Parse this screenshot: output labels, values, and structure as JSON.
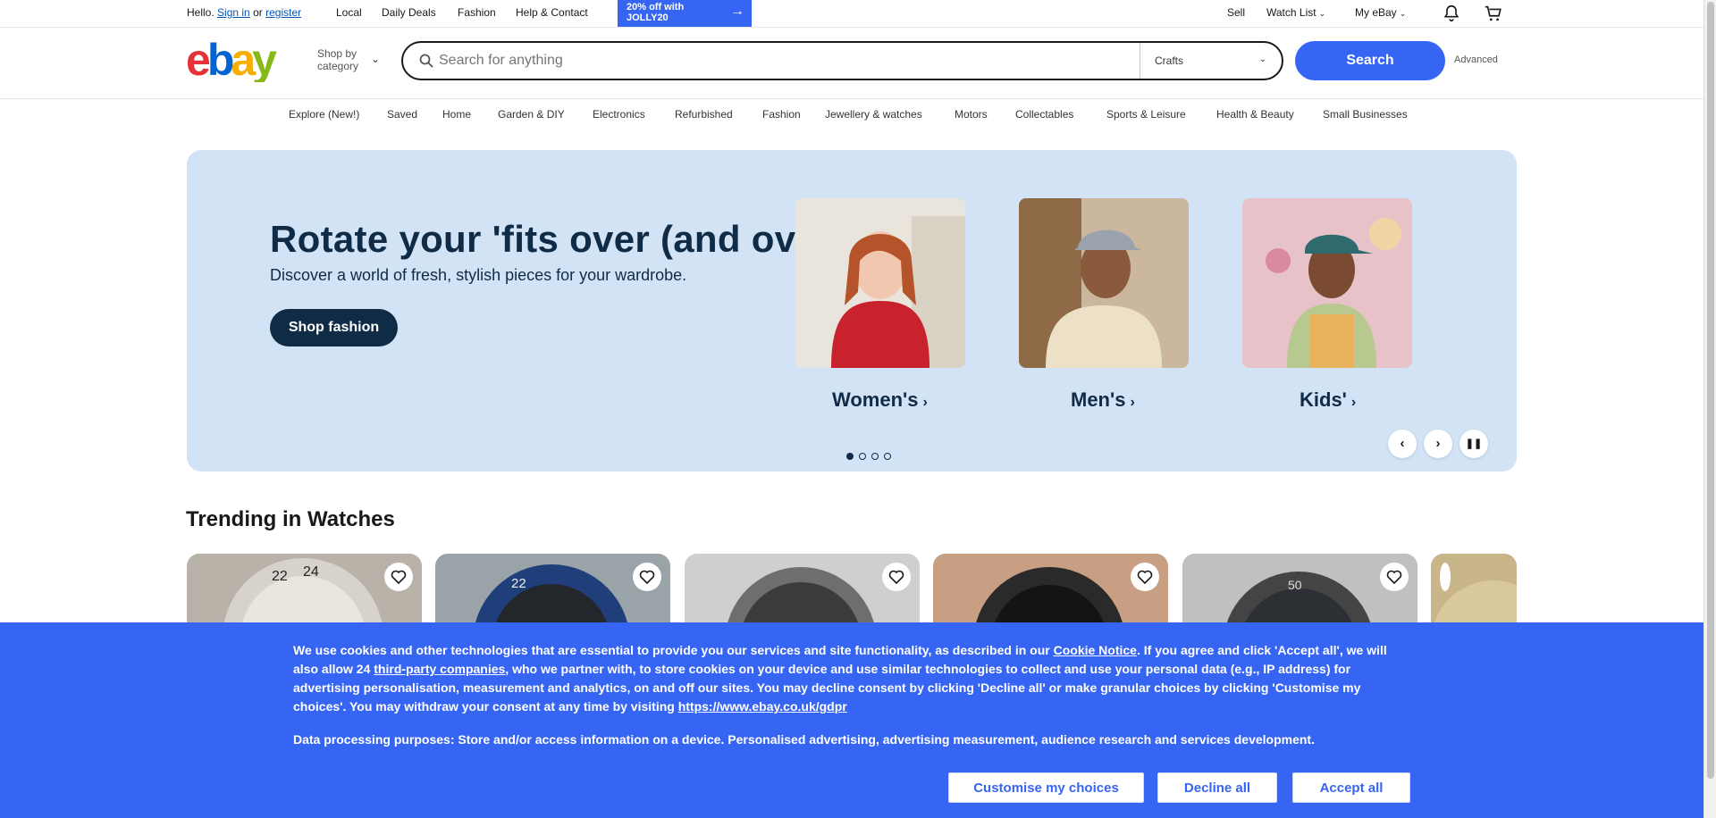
{
  "topbar": {
    "hello": "Hello.",
    "sign_in": "Sign in",
    "or": "or",
    "register": "register",
    "links": [
      "Local",
      "Daily Deals",
      "Fashion",
      "Help & Contact"
    ],
    "promo": "20% off with JOLLY20",
    "sell": "Sell",
    "watch_list": "Watch List",
    "my_ebay": "My eBay"
  },
  "header": {
    "shop_by_category": "Shop by category",
    "search_placeholder": "Search for anything",
    "category_selected": "Crafts",
    "search_button": "Search",
    "advanced": "Advanced"
  },
  "nav": {
    "items": [
      "Explore (New!)",
      "Saved",
      "Home",
      "Garden & DIY",
      "Electronics",
      "Refurbished",
      "Fashion",
      "Jewellery & watches",
      "Motors",
      "Collectables",
      "Sports & Leisure",
      "Health & Beauty",
      "Small Businesses"
    ]
  },
  "hero": {
    "title": "Rotate your 'fits over (and over)",
    "subtitle": "Discover a world of fresh, stylish pieces for your wardrobe.",
    "cta": "Shop fashion",
    "tiles": [
      "Women's",
      "Men's",
      "Kids'"
    ],
    "slide_count": 4,
    "active_slide": 1
  },
  "trending": {
    "title": "Trending in Watches"
  },
  "consent": {
    "p1": "We use cookies and other technologies that are essential to provide you our services and site functionality, as described in our ",
    "cookie_notice": "Cookie Notice",
    "p2": ". If you agree and click 'Accept all', we will also allow 24 ",
    "third_party": "third-party companies",
    "p3": ", who we partner with, to store cookies on your device and use similar technologies to collect and use your personal data (e.g., IP address) for advertising personalisation, measurement and analytics, on and off our sites. You may decline consent by clicking 'Decline all' or make granular choices by clicking 'Customise my choices'. You may withdraw your consent at any time by visiting ",
    "gdpr_link": "https://www.ebay.co.uk/gdpr",
    "purposes": "Data processing purposes: Store and/or access information on a device. Personalised advertising, advertising measurement, audience research and services development.",
    "customise": "Customise my choices",
    "decline": "Decline all",
    "accept": "Accept all"
  },
  "colors": {
    "ebay_red": "#e53238",
    "ebay_blue": "#0064d2",
    "ebay_yellow": "#f5af02",
    "ebay_green": "#86b817",
    "accent": "#3665f3",
    "hero_bg": "#d3e3f6",
    "hero_text": "#0f2b46"
  },
  "icons": [
    "bell-icon",
    "cart-icon",
    "search-icon",
    "chevron-down-icon",
    "heart-icon",
    "pause-icon"
  ]
}
